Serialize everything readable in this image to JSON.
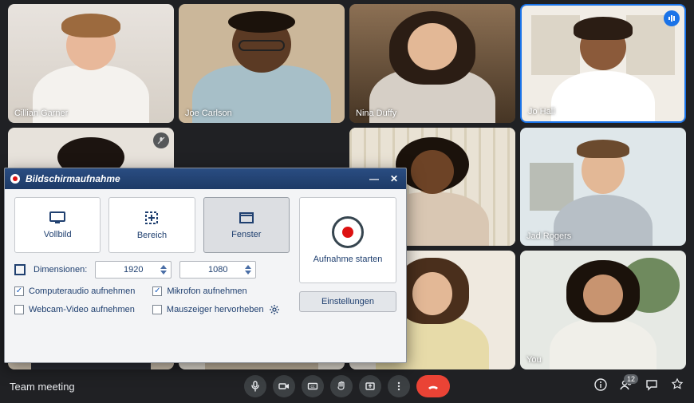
{
  "participants": [
    {
      "name": "Cillian Garner"
    },
    {
      "name": "Joe Carlson"
    },
    {
      "name": "Nina Duffy"
    },
    {
      "name": "Jo Hall",
      "speaking": true
    },
    {
      "name": "",
      "muted": true
    },
    {
      "name": ""
    },
    {
      "name": ""
    },
    {
      "name": "Jad Rogers"
    },
    {
      "name": ""
    },
    {
      "name": ""
    },
    {
      "name": ""
    },
    {
      "name": "You"
    }
  ],
  "bottombar": {
    "meeting_name": "Team meeting",
    "participant_count": "12"
  },
  "dialog": {
    "title": "Bildschirmaufnahme",
    "modes": {
      "fullscreen": "Vollbild",
      "region": "Bereich",
      "window": "Fenster"
    },
    "selected_mode": "window",
    "dimensions_label": "Dimensionen:",
    "width": "1920",
    "height": "1080",
    "checks": {
      "computeraudio": "Computeraudio aufnehmen",
      "mic": "Mikrofon aufnehmen",
      "webcam": "Webcam-Video aufnehmen",
      "cursor": "Mauszeiger hervorheben"
    },
    "check_state": {
      "computeraudio": true,
      "mic": true,
      "webcam": false,
      "cursor": false
    },
    "record_label": "Aufnahme starten",
    "settings_label": "Einstellungen"
  }
}
